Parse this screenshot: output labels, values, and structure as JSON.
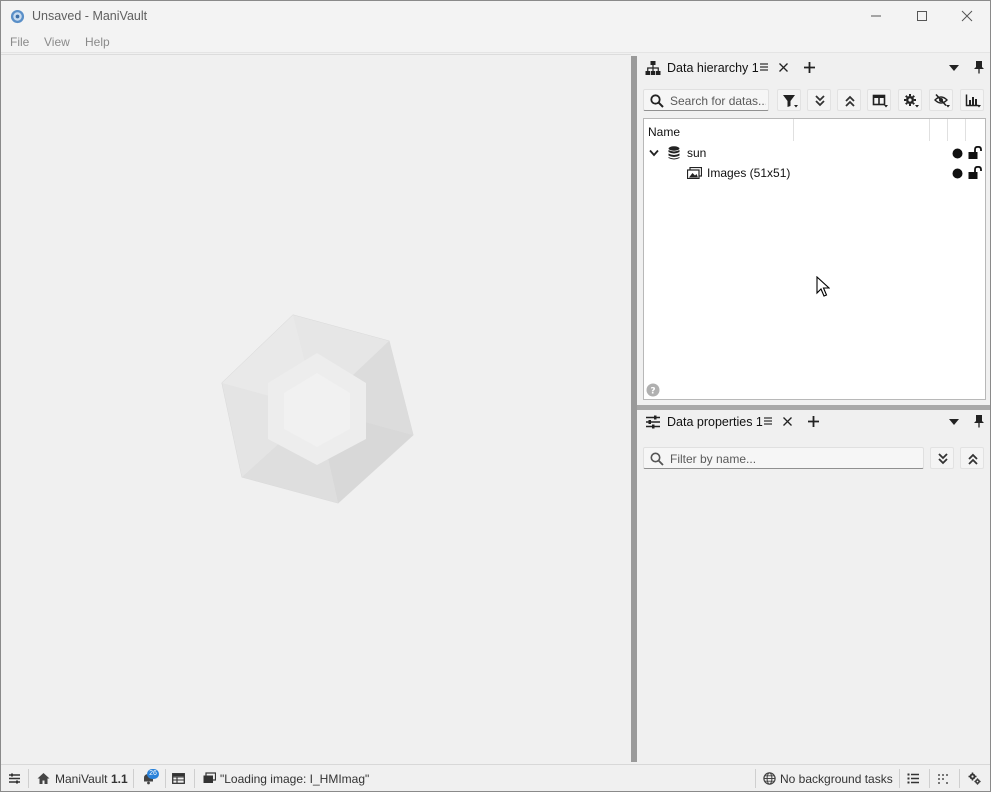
{
  "window": {
    "title": "Unsaved - ManiVault"
  },
  "menu": {
    "items": [
      "File",
      "View",
      "Help"
    ]
  },
  "data_hierarchy": {
    "tab_label": "Data hierarchy 1",
    "search_placeholder": "Search for datas...",
    "column_name": "Name",
    "rows": [
      {
        "label": "sun",
        "expanded": true,
        "icon": "database-icon"
      },
      {
        "label": "Images (51x51)",
        "icon": "images-icon"
      }
    ]
  },
  "data_properties": {
    "tab_label": "Data properties 1",
    "filter_placeholder": "Filter by name..."
  },
  "status": {
    "app_name": "ManiVault",
    "app_version": "1.1",
    "notification_count": "26",
    "loading_text": "\"Loading image: I_HMImag\"",
    "background_tasks": "No background tasks"
  },
  "colors": {
    "accent": "#2a82da",
    "splitter": "#9a9a9a"
  }
}
